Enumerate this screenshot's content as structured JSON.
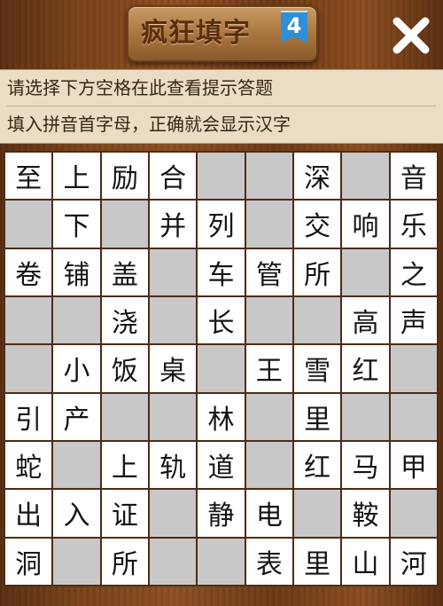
{
  "header": {
    "logo_text": "疯狂填字",
    "logo_badge": "4",
    "close_icon": "close-icon"
  },
  "hints": {
    "line1": "请选择下方空格在此查看提示答题",
    "line2": "填入拼音首字母，正确就会显示汉字"
  },
  "grid": [
    [
      "至",
      "上",
      "励",
      "合",
      "",
      "",
      "深",
      "",
      "音"
    ],
    [
      "",
      "下",
      "",
      "并",
      "列",
      "",
      "交",
      "响",
      "乐"
    ],
    [
      "卷",
      "铺",
      "盖",
      "",
      "车",
      "管",
      "所",
      "",
      "之"
    ],
    [
      "",
      "",
      "浇",
      "",
      "长",
      "",
      "",
      "高",
      "声"
    ],
    [
      "",
      "小",
      "饭",
      "桌",
      "",
      "王",
      "雪",
      "红",
      ""
    ],
    [
      "引",
      "产",
      "",
      "",
      "林",
      "",
      "里",
      "",
      ""
    ],
    [
      "蛇",
      "",
      "上",
      "轨",
      "道",
      "",
      "红",
      "马",
      "甲"
    ],
    [
      "出",
      "入",
      "证",
      "",
      "静",
      "电",
      "",
      "鞍",
      ""
    ],
    [
      "洞",
      "",
      "所",
      "",
      "",
      "表",
      "里",
      "山",
      "河"
    ]
  ]
}
